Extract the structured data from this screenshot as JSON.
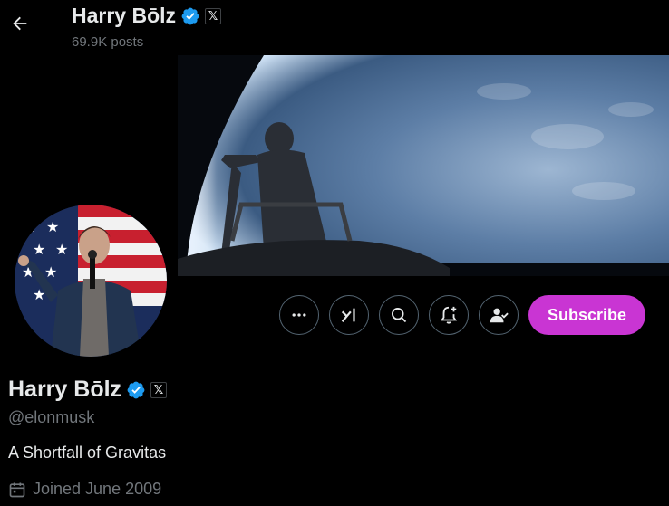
{
  "header": {
    "name": "Harry Bōlz",
    "posts": "69.9K posts",
    "x_badge": "𝕏"
  },
  "actions": {
    "subscribe_label": "Subscribe"
  },
  "profile": {
    "name": "Harry Bōlz",
    "x_badge": "𝕏",
    "handle": "@elonmusk",
    "bio": "A Shortfall of Gravitas",
    "joined": "Joined June 2009"
  },
  "colors": {
    "accent_subscribe": "#c935d3",
    "verified": "#1d9bf0",
    "secondary_text": "#71767b",
    "primary_text": "#e7e9ea",
    "border": "#536471"
  },
  "icons": {
    "back": "arrow-left-icon",
    "verified": "verified-badge-icon",
    "more": "more-icon",
    "grok": "grok-icon",
    "search": "search-icon",
    "notify": "bell-plus-icon",
    "following": "person-check-icon",
    "calendar": "calendar-icon"
  }
}
